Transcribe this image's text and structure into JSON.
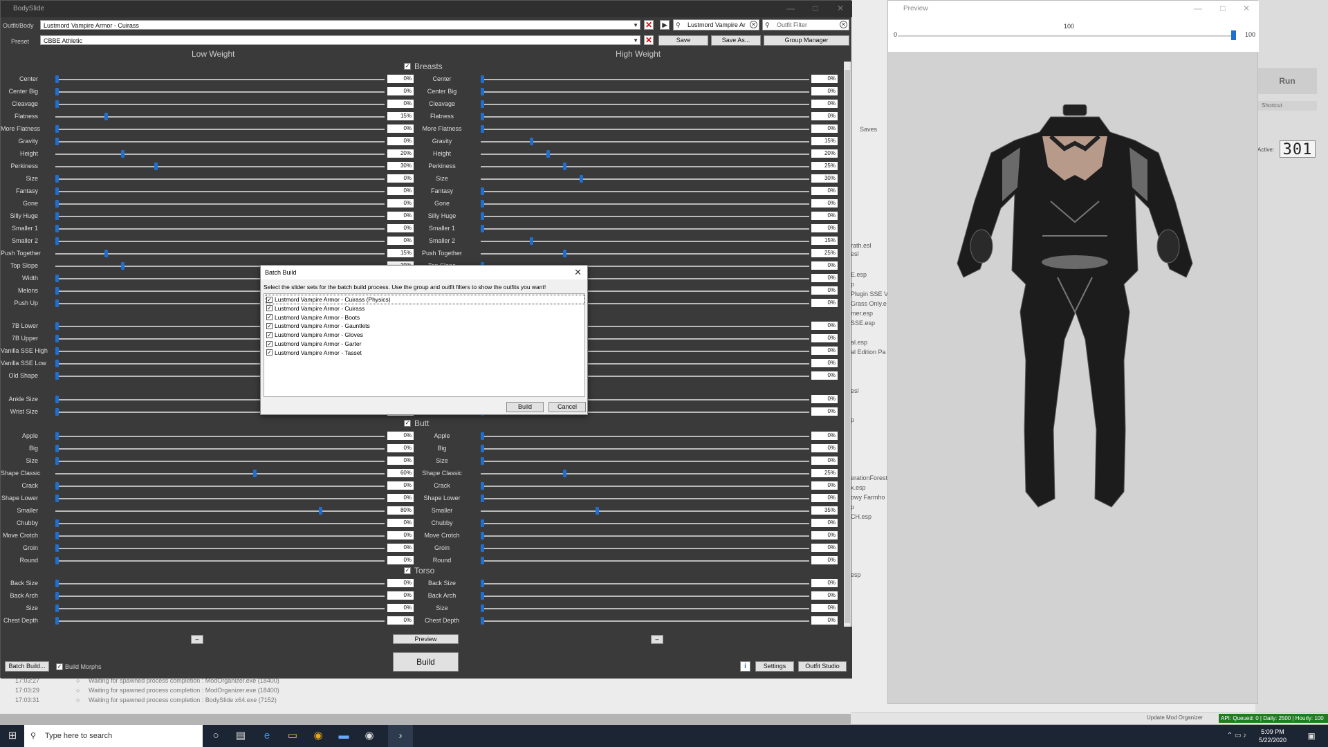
{
  "bodyslide": {
    "title": "BodySlide",
    "outfit_label": "Outfit/Body",
    "outfit_value": "Lustmord Vampire Armor - Cuirass",
    "preset_label": "Preset",
    "preset_value": "CBBE Athletic",
    "search_value": "Lustmord Vampire Ar",
    "outfit_filter_placeholder": "Outfit Filter",
    "save": "Save",
    "save_as": "Save As...",
    "group_manager": "Group Manager",
    "low_weight": "Low Weight",
    "high_weight": "High Weight",
    "batch_build": "Batch Build...",
    "build_morphs": "Build Morphs",
    "preview": "Preview",
    "build": "Build",
    "settings": "Settings",
    "outfit_studio": "Outfit Studio",
    "minus": "–"
  },
  "groups": [
    {
      "name": "Breasts",
      "sliders": [
        {
          "name": "Center",
          "low": 0,
          "high": 0
        },
        {
          "name": "Center Big",
          "low": 0,
          "high": 0
        },
        {
          "name": "Cleavage",
          "low": 0,
          "high": 0
        },
        {
          "name": "Flatness",
          "low": 15,
          "high": 0
        },
        {
          "name": "More Flatness",
          "low": 0,
          "high": 0
        },
        {
          "name": "Gravity",
          "low": 0,
          "high": 15
        },
        {
          "name": "Height",
          "low": 20,
          "high": 20
        },
        {
          "name": "Perkiness",
          "low": 30,
          "high": 25
        },
        {
          "name": "Size",
          "low": 0,
          "high": 30
        },
        {
          "name": "Fantasy",
          "low": 0,
          "high": 0
        },
        {
          "name": "Gone",
          "low": 0,
          "high": 0
        },
        {
          "name": "Silly Huge",
          "low": 0,
          "high": 0
        },
        {
          "name": "Smaller 1",
          "low": 0,
          "high": 0
        },
        {
          "name": "Smaller 2",
          "low": 0,
          "high": 15
        },
        {
          "name": "Push Together",
          "low": 15,
          "high": 25
        },
        {
          "name": "Top Slope",
          "low": 20,
          "high": 0
        },
        {
          "name": "Width",
          "low": 0,
          "high": 0
        },
        {
          "name": "Melons",
          "low": 0,
          "high": 0
        },
        {
          "name": "Push Up",
          "low": 0,
          "high": 0
        }
      ]
    },
    {
      "name": "",
      "sliders": [
        {
          "name": "7B Lower",
          "low": 0,
          "high": 0
        },
        {
          "name": "7B Upper",
          "low": 0,
          "high": 0
        },
        {
          "name": "Vanilla SSE High",
          "low": 0,
          "high": 0
        },
        {
          "name": "Vanilla SSE Low",
          "low": 0,
          "high": 0
        },
        {
          "name": "Old Shape",
          "low": 0,
          "high": 0
        }
      ]
    },
    {
      "name": "",
      "sliders": [
        {
          "name": "Ankle Size",
          "low": 0,
          "high": 0
        },
        {
          "name": "Wrist Size",
          "low": 0,
          "high": 0
        }
      ]
    },
    {
      "name": "Butt",
      "sliders": [
        {
          "name": "Apple",
          "low": 0,
          "high": 0
        },
        {
          "name": "Big",
          "low": 0,
          "high": 0
        },
        {
          "name": "Size",
          "low": 0,
          "high": 0
        },
        {
          "name": "Shape Classic",
          "low": 60,
          "high": 25
        },
        {
          "name": "Crack",
          "low": 0,
          "high": 0
        },
        {
          "name": "Shape Lower",
          "low": 0,
          "high": 0
        },
        {
          "name": "Smaller",
          "low": 80,
          "high": 35
        },
        {
          "name": "Chubby",
          "low": 0,
          "high": 0
        },
        {
          "name": "Move Crotch",
          "low": 0,
          "high": 0
        },
        {
          "name": "Groin",
          "low": 0,
          "high": 0
        },
        {
          "name": "Round",
          "low": 0,
          "high": 0
        }
      ]
    },
    {
      "name": "Torso",
      "sliders": [
        {
          "name": "Back Size",
          "low": 0,
          "high": 0
        },
        {
          "name": "Back Arch",
          "low": 0,
          "high": 0
        },
        {
          "name": "Size",
          "low": 0,
          "high": 0
        },
        {
          "name": "Chest Depth",
          "low": 0,
          "high": 0
        }
      ]
    }
  ],
  "dialog": {
    "title": "Batch Build",
    "message": "Select the slider sets for the batch build process. Use the group and outfit filters to show the outfits you want!",
    "items": [
      "Lustmord Vampire Armor - Cuirass (Physics)",
      "Lustmord Vampire Armor - Cuirass",
      "Lustmord Vampire Armor - Boots",
      "Lustmord Vampire Armor - Gauntlets",
      "Lustmord Vampire Armor - Gloves",
      "Lustmord Vampire Armor - Garter",
      "Lustmord Vampire Armor - Tasset"
    ],
    "build": "Build",
    "cancel": "Cancel"
  },
  "preview": {
    "title": "Preview",
    "min": "0",
    "mid": "100",
    "max": "100",
    "weight": 1.0
  },
  "mo": {
    "run": "Run",
    "shortcut": "Shortcut",
    "active_label": "Active:",
    "active_count": "301",
    "saves": "Saves",
    "list": [
      "rath.esl",
      "esl",
      "E.esp",
      "p",
      "Plugin SSE V",
      "Grass Only.e",
      "mer.esp",
      "SSE.esp",
      "al.esp",
      "al Edition Pa",
      "esl",
      "p",
      "erationForest",
      "x.esp",
      "owy Farmho",
      "p",
      "CH.esp",
      "esp"
    ],
    "update": "Update Mod Organizer",
    "api": "API: Queued: 0 | Daily: 2500 | Hourly: 100"
  },
  "log": [
    {
      "time": "17:03:27",
      "text": "Waiting for spawned process completion : ModOrganizer.exe (18400)"
    },
    {
      "time": "17:03:29",
      "text": "Waiting for spawned process completion : ModOrganizer.exe (18400)"
    },
    {
      "time": "17:03:31",
      "text": "Waiting for spawned process completion : BodySlide x64.exe (7152)"
    }
  ],
  "taskbar": {
    "search": "Type here to search",
    "time": "5:09 PM",
    "date": "5/22/2020"
  },
  "colors": {
    "accent": "#1e6fd0",
    "api_green": "#1f7d1f"
  }
}
